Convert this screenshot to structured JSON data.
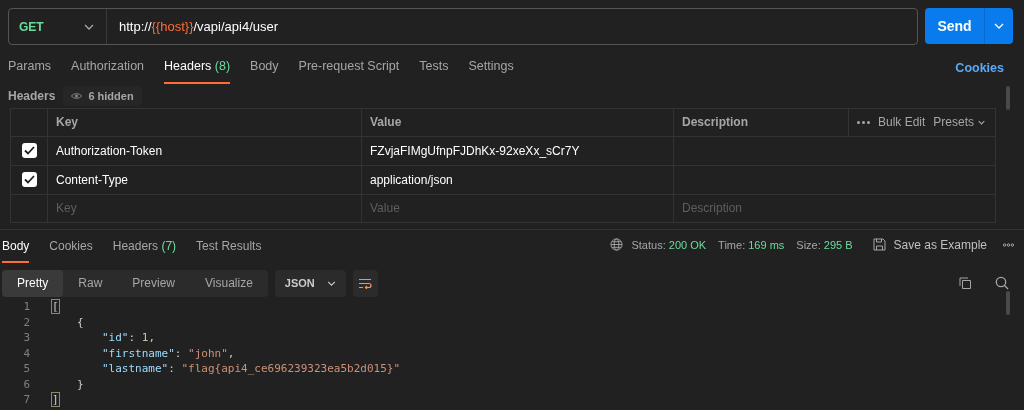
{
  "request": {
    "method": "GET",
    "url": [
      {
        "kind": "text",
        "text": "http://"
      },
      {
        "kind": "variable",
        "text": "{{host}}"
      },
      {
        "kind": "text",
        "text": "/vapi/api4/user"
      }
    ],
    "send": "Send"
  },
  "request_tabs": [
    {
      "label": "Params",
      "selected": false
    },
    {
      "label": "Authorization",
      "selected": false
    },
    {
      "label": "Headers",
      "count": "(8)",
      "selected": true
    },
    {
      "label": "Body",
      "selected": false
    },
    {
      "label": "Pre-request Script",
      "selected": false
    },
    {
      "label": "Tests",
      "selected": false
    },
    {
      "label": "Settings",
      "selected": false
    }
  ],
  "cookies_link": "Cookies",
  "headers_section": {
    "title": "Headers",
    "hidden": "6 hidden"
  },
  "headers_table": {
    "columns": [
      "Key",
      "Value",
      "Description"
    ],
    "actions": [
      "Bulk Edit",
      "Presets"
    ],
    "rows": [
      {
        "checked": true,
        "key": "Authorization-Token",
        "value": "FZvjaFIMgUfnpFJDhKx-92xeXx_sCr7Y"
      },
      {
        "checked": true,
        "key": "Content-Type",
        "value": "application/json"
      }
    ],
    "placeholder_row": {
      "key_placeholder": "Key",
      "value_placeholder": "Value",
      "description_placeholder": "Description"
    }
  },
  "response_tabs": [
    {
      "label": "Body",
      "selected": true
    },
    {
      "label": "Cookies",
      "selected": false
    },
    {
      "label": "Headers",
      "count": "(7)",
      "selected": false
    },
    {
      "label": "Test Results",
      "selected": false
    }
  ],
  "response_meta": [
    {
      "label": "Status:",
      "value": "200 OK"
    },
    {
      "label": "Time:",
      "value": "169 ms"
    },
    {
      "label": "Size:",
      "value": "295 B"
    }
  ],
  "save_example": "Save as Example",
  "view_modes": [
    {
      "label": "Pretty",
      "selected": true
    },
    {
      "label": "Raw",
      "selected": false
    },
    {
      "label": "Preview",
      "selected": false
    },
    {
      "label": "Visualize",
      "selected": false
    }
  ],
  "format": "JSON",
  "code": [
    {
      "number": "1",
      "tokens": [
        {
          "kind": "bracket",
          "text": "["
        }
      ],
      "children": [
        {
          "number": "2",
          "tokens": [
            {
              "kind": "punct",
              "text": "{"
            }
          ],
          "children": [
            {
              "number": "3",
              "tokens": [
                {
                  "kind": "key",
                  "text": "\"id\""
                },
                {
                  "kind": "punct",
                  "text": ": "
                },
                {
                  "kind": "number",
                  "text": "1"
                },
                {
                  "kind": "punct",
                  "text": ","
                }
              ]
            },
            {
              "number": "4",
              "tokens": [
                {
                  "kind": "key",
                  "text": "\"firstname\""
                },
                {
                  "kind": "punct",
                  "text": ": "
                },
                {
                  "kind": "string",
                  "text": "\"john\""
                },
                {
                  "kind": "punct",
                  "text": ","
                }
              ]
            },
            {
              "number": "5",
              "tokens": [
                {
                  "kind": "key",
                  "text": "\"lastname\""
                },
                {
                  "kind": "punct",
                  "text": ": "
                },
                {
                  "kind": "string",
                  "text": "\"flag{api4_ce696239323ea5b2d015}\""
                }
              ]
            }
          ],
          "closing": {
            "number": "6",
            "tokens": [
              {
                "kind": "punct",
                "text": "}"
              }
            ]
          }
        }
      ],
      "closing": {
        "number": "7",
        "tokens": [
          {
            "kind": "bracket",
            "text": "]"
          }
        ]
      }
    }
  ]
}
